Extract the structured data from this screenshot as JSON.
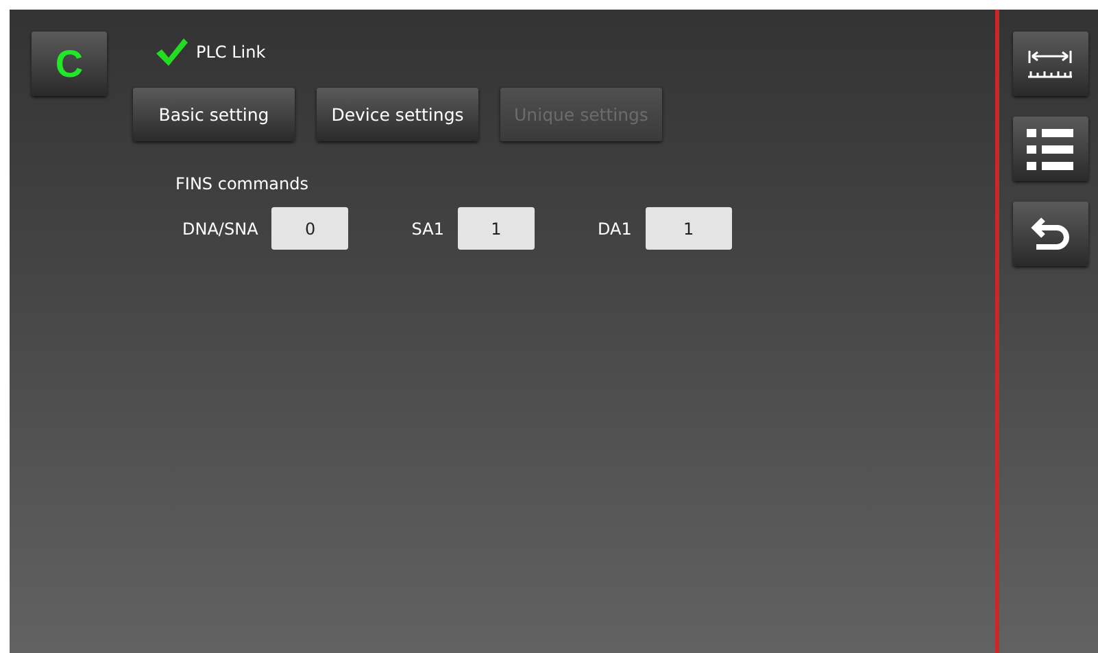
{
  "mode_button": {
    "label": "C"
  },
  "link_status": {
    "label": "PLC Link",
    "connected": true
  },
  "tabs": [
    {
      "label": "Basic setting",
      "disabled": false
    },
    {
      "label": "Device settings",
      "disabled": false
    },
    {
      "label": "Unique settings",
      "disabled": true
    }
  ],
  "section": {
    "title": "FINS commands",
    "fields": [
      {
        "label": "DNA/SNA",
        "value": "0"
      },
      {
        "label": "SA1",
        "value": "1"
      },
      {
        "label": "DA1",
        "value": "1"
      }
    ]
  }
}
